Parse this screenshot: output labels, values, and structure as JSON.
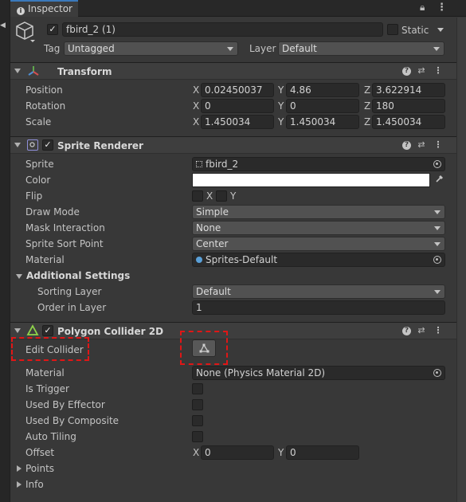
{
  "tab": {
    "title": "Inspector"
  },
  "header": {
    "object_name": "fbird_2 (1)",
    "static_label": "Static",
    "tag_label": "Tag",
    "tag_value": "Untagged",
    "layer_label": "Layer",
    "layer_value": "Default"
  },
  "transform": {
    "title": "Transform",
    "position_label": "Position",
    "rotation_label": "Rotation",
    "scale_label": "Scale",
    "axes": [
      "X",
      "Y",
      "Z"
    ],
    "position": [
      "0.02450037",
      "4.86",
      "3.622914"
    ],
    "rotation": [
      "0",
      "0",
      "180"
    ],
    "scale": [
      "1.450034",
      "1.450034",
      "1.450034"
    ]
  },
  "sprite_renderer": {
    "title": "Sprite Renderer",
    "sprite_label": "Sprite",
    "sprite_value": "fbird_2",
    "color_label": "Color",
    "color_value": "#ffffff",
    "flip_label": "Flip",
    "flip_x": "X",
    "flip_y": "Y",
    "draw_mode_label": "Draw Mode",
    "draw_mode_value": "Simple",
    "mask_label": "Mask Interaction",
    "mask_value": "None",
    "sort_point_label": "Sprite Sort Point",
    "sort_point_value": "Center",
    "material_label": "Material",
    "material_value": "Sprites-Default",
    "additional_title": "Additional Settings",
    "sorting_layer_label": "Sorting Layer",
    "sorting_layer_value": "Default",
    "order_label": "Order in Layer",
    "order_value": "1"
  },
  "polygon_collider": {
    "title": "Polygon Collider 2D",
    "edit_label": "Edit Collider",
    "material_label": "Material",
    "material_value": "None (Physics Material 2D)",
    "is_trigger_label": "Is Trigger",
    "used_by_effector_label": "Used By Effector",
    "used_by_composite_label": "Used By Composite",
    "auto_tiling_label": "Auto Tiling",
    "offset_label": "Offset",
    "offset_x_axis": "X",
    "offset_y_axis": "Y",
    "offset_x": "0",
    "offset_y": "0",
    "points_label": "Points",
    "info_label": "Info"
  },
  "colors": {
    "background": "#383838",
    "section_header": "#3e3e3e",
    "highlight_dashed": "#e01616",
    "tab_accent": "#3a79bb"
  }
}
